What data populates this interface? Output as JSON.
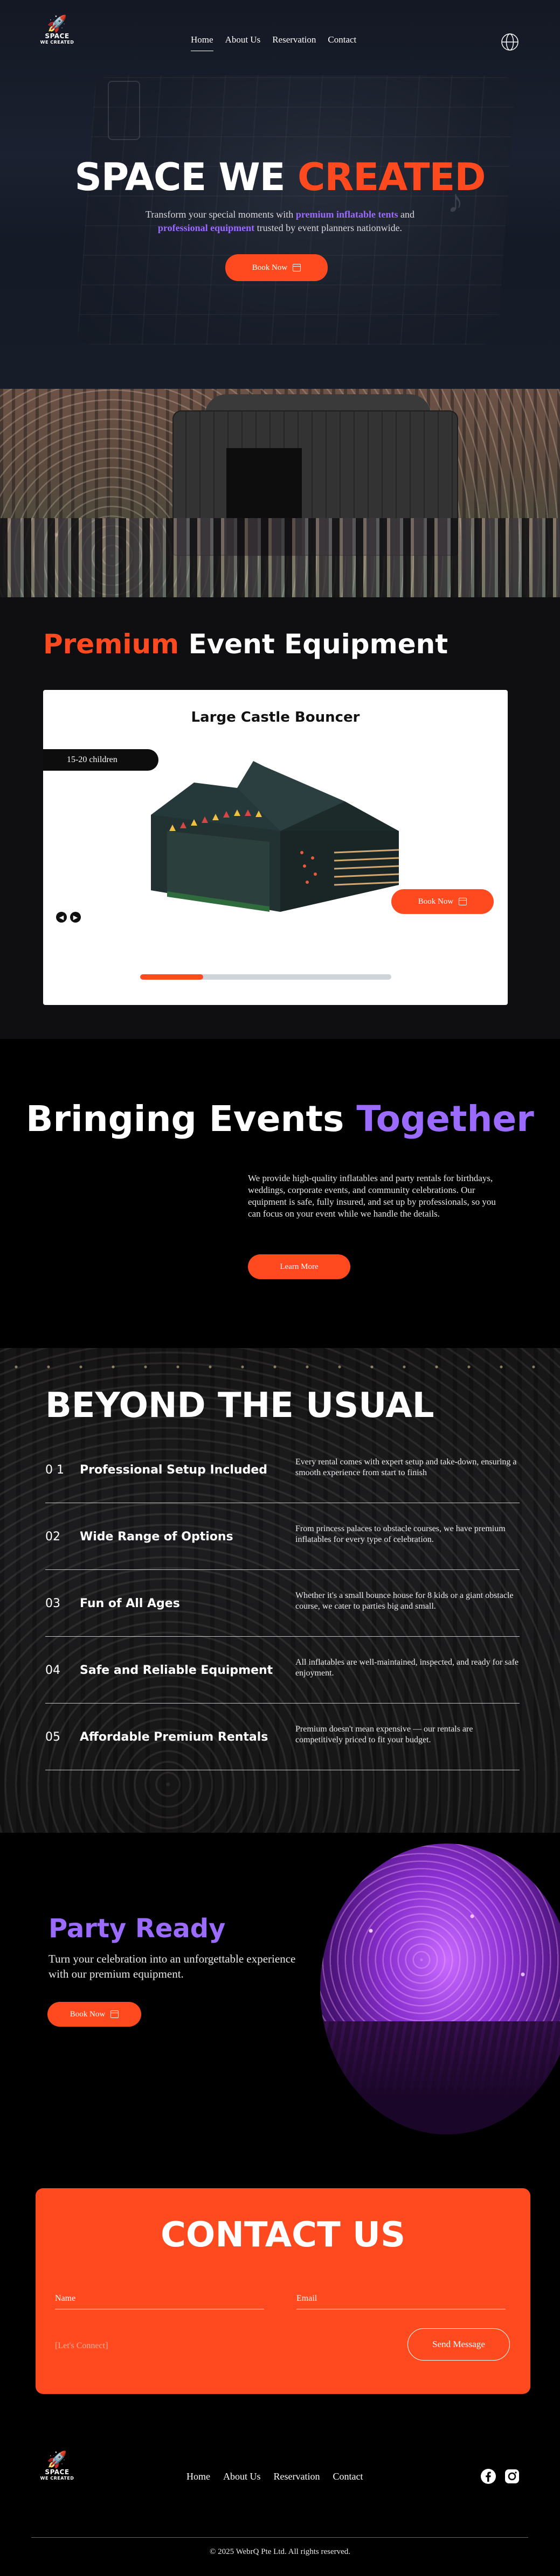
{
  "brand": {
    "line1": "SPACE",
    "line2": "WE CREATED"
  },
  "nav": {
    "items": [
      "Home",
      "About Us",
      "Reservation",
      "Contact"
    ],
    "active": "Home",
    "language_icon": "globe-icon"
  },
  "hero": {
    "title_white": "SPACE WE ",
    "title_accent": "CREATED",
    "subtitle_pre": "Transform your special moments with ",
    "subtitle_hl1": "premium inflatable tents",
    "subtitle_mid": " and",
    "subtitle_hl2": "professional equipment",
    "subtitle_post": " trusted by event planners nationwide.",
    "button": "Book Now",
    "accent_color": "#ff4a1f",
    "highlight_color": "#9b6bff"
  },
  "premium": {
    "title_accent": "Premium",
    "title_rest": " Event Equipment",
    "card": {
      "title": "Large Castle Bouncer",
      "capacity": "15-20 children",
      "button": "Book Now",
      "prev_icon": "arrow-left-icon",
      "next_icon": "arrow-right-icon"
    },
    "carousel_progress": 0.25
  },
  "together": {
    "title_white": "Bringing Events ",
    "title_purple": "Together",
    "text": "We provide high-quality inflatables and party rentals for birthdays, weddings, corporate events, and community celebrations. Our equipment is safe, fully insured, and set up by professionals, so you can focus on your event while we handle the details.",
    "button": "Learn More"
  },
  "beyond": {
    "title": "BEYOND THE USUAL",
    "rows": [
      {
        "num": "0 1",
        "label": "Professional Setup Included",
        "desc": "Every rental comes with expert setup and take-down, ensuring a smooth experience from start to finish"
      },
      {
        "num": "02",
        "label": "Wide Range of Options",
        "desc": "From princess palaces to obstacle courses, we have premium inflatables for every type of celebration."
      },
      {
        "num": "03",
        "label": "Fun of All Ages",
        "desc": "Whether it's a small bounce house for 8 kids or a giant obstacle course, we cater to parties big and small."
      },
      {
        "num": "04",
        "label": "Safe and Reliable Equipment",
        "desc": "All inflatables are well-maintained, inspected, and ready for safe enjoyment."
      },
      {
        "num": "05",
        "label": "Affordable Premium Rentals",
        "desc": " Premium doesn't mean expensive — our rentals are competitively priced to fit your budget."
      }
    ]
  },
  "party": {
    "title": "Party Ready",
    "text": "Turn your celebration into an unforgettable experience with our premium equipment.",
    "button": "Book Now"
  },
  "contact": {
    "title": "CONTACT US",
    "name_label": "Name",
    "email_label": "Email",
    "message_placeholder": "[Let's Connect]",
    "send": "Send Message"
  },
  "footer": {
    "links": [
      "Home",
      "About Us",
      "Reservation",
      "Contact"
    ],
    "social": [
      "facebook-icon",
      "instagram-icon"
    ],
    "copyright": "© 2025 WebrQ Pte Ltd. All rights reserved."
  }
}
